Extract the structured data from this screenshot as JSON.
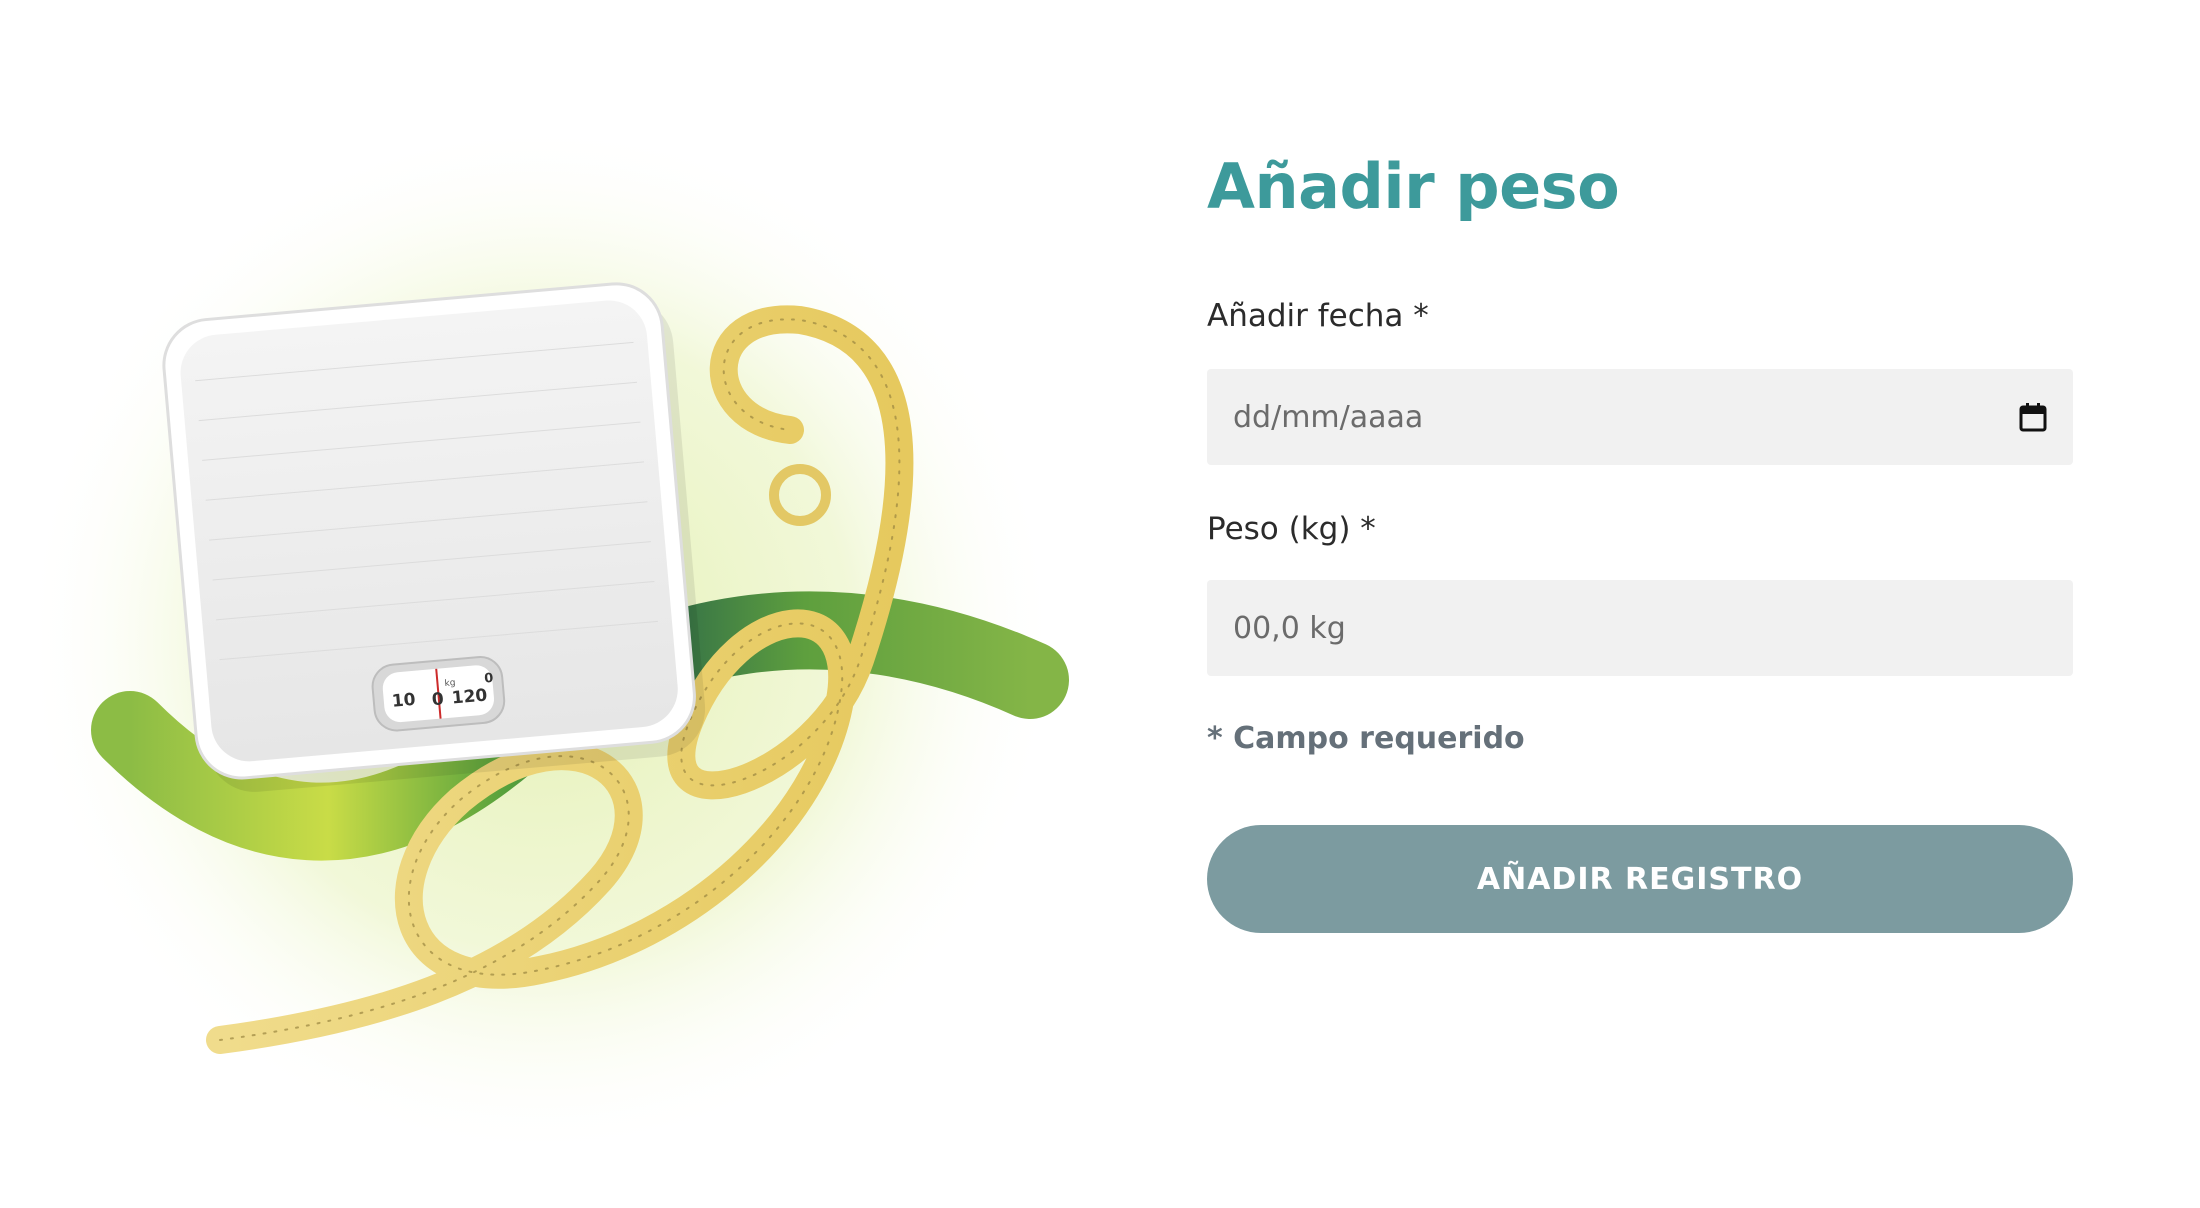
{
  "form": {
    "title": "Añadir peso",
    "date_label": "Añadir fecha *",
    "date_placeholder": "dd/mm/aaaa",
    "weight_label": "Peso (kg) *",
    "weight_placeholder": "00,0 kg",
    "required_note": "* Campo requerido",
    "submit_label": "AÑADIR REGISTRO"
  },
  "illustration": {
    "scale_dial_numbers": [
      "10",
      "0",
      "120",
      "0"
    ],
    "scale_dial_unit": "kg"
  },
  "icons": {
    "calendar": "calendar-icon"
  },
  "colors": {
    "title": "#3d9a9b",
    "button": "#7c9ba0",
    "input_bg": "#f1f1f1",
    "note": "#657079",
    "wave_start": "#c9dc47",
    "wave_end": "#7fb044"
  }
}
